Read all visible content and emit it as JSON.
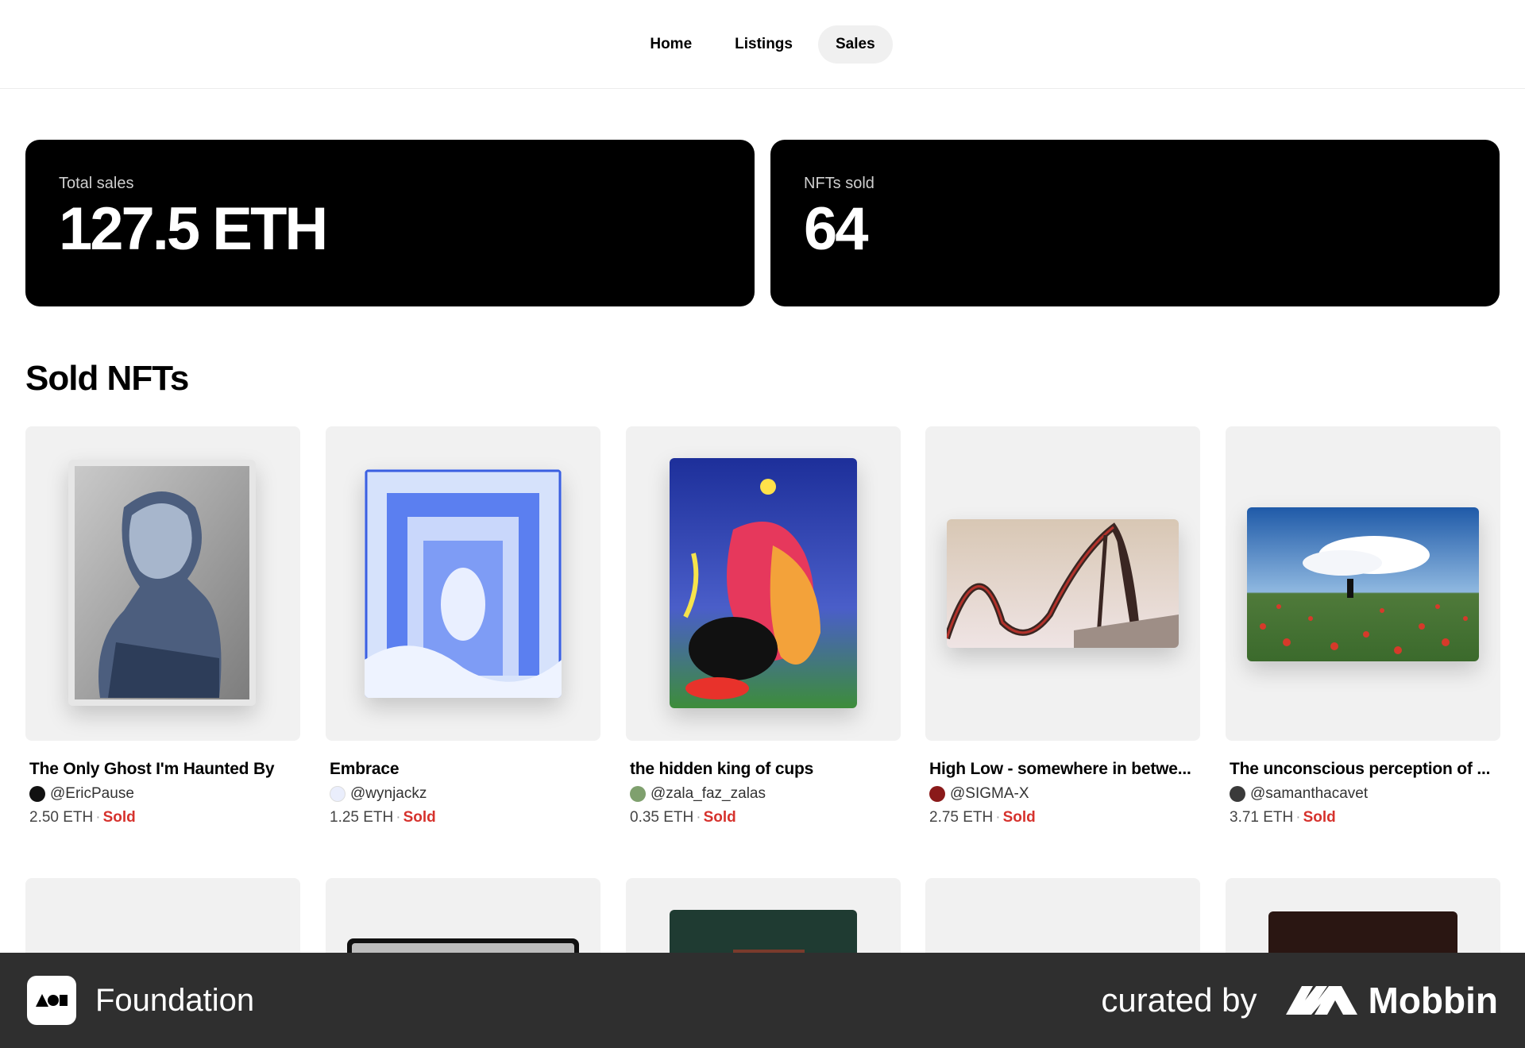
{
  "nav": {
    "items": [
      {
        "label": "Home",
        "active": false
      },
      {
        "label": "Listings",
        "active": false
      },
      {
        "label": "Sales",
        "active": true
      }
    ]
  },
  "stats": {
    "total_sales": {
      "label": "Total sales",
      "value": "127.5 ETH"
    },
    "nfts_sold": {
      "label": "NFTs sold",
      "value": "64"
    }
  },
  "section": {
    "title": "Sold NFTs"
  },
  "cards": [
    {
      "title": "The Only Ghost I'm Haunted By",
      "creator": "@EricPause",
      "price": "2.50 ETH",
      "status": "Sold"
    },
    {
      "title": "Embrace",
      "creator": "@wynjackz",
      "price": "1.25 ETH",
      "status": "Sold"
    },
    {
      "title": "the hidden king of cups",
      "creator": "@zala_faz_zalas",
      "price": "0.35 ETH",
      "status": "Sold"
    },
    {
      "title": "High Low - somewhere in betwe...",
      "creator": "@SIGMA-X",
      "price": "2.75 ETH",
      "status": "Sold"
    },
    {
      "title": "The unconscious perception of ...",
      "creator": "@samanthacavet",
      "price": "3.71 ETH",
      "status": "Sold"
    }
  ],
  "footer": {
    "brand": "Foundation",
    "curated_by": "curated by",
    "curator": "Mobbin"
  },
  "colors": {
    "sold": "#d6322d",
    "footer_bg": "#2f2f2f",
    "stat_bg": "#000000"
  }
}
